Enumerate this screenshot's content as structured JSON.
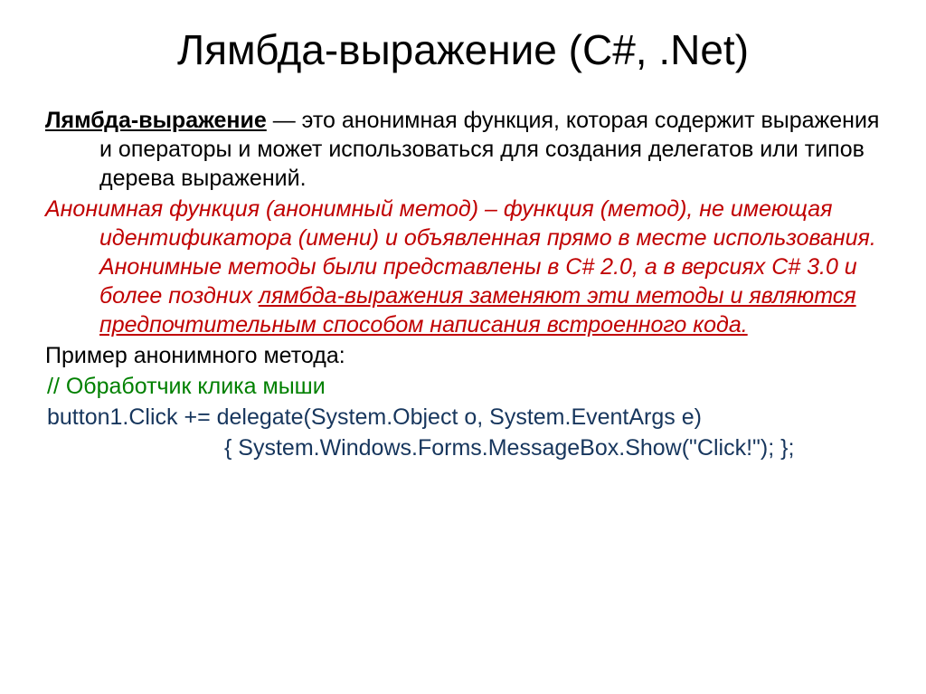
{
  "title": "Лямбда-выражение (C#, .Net)",
  "definition": {
    "term": "Лямбда-выражение",
    "body": " — это анонимная функция, которая содержит выражения и операторы и может использоваться для создания делегатов или типов дерева выражений."
  },
  "anonymous": {
    "part1": "Анонимная функция (анонимный метод) – функция (метод), не имеющая идентификатора (имени) и объявленная прямо в месте использования. Анонимные методы были представлены в C# 2.0, а в версиях C# 3.0 и более поздних ",
    "part2": "лямбда-выражения заменяют эти методы и являются предпочтительным способом написания встроенного кода.",
    "example_label": "Пример анонимного метода:"
  },
  "code": {
    "comment": "// Обработчик клика мыши",
    "line1": "button1.Click += delegate(System.Object o, System.EventArgs e)",
    "line2": "{ System.Windows.Forms.MessageBox.Show(\"Click!\"); };"
  }
}
